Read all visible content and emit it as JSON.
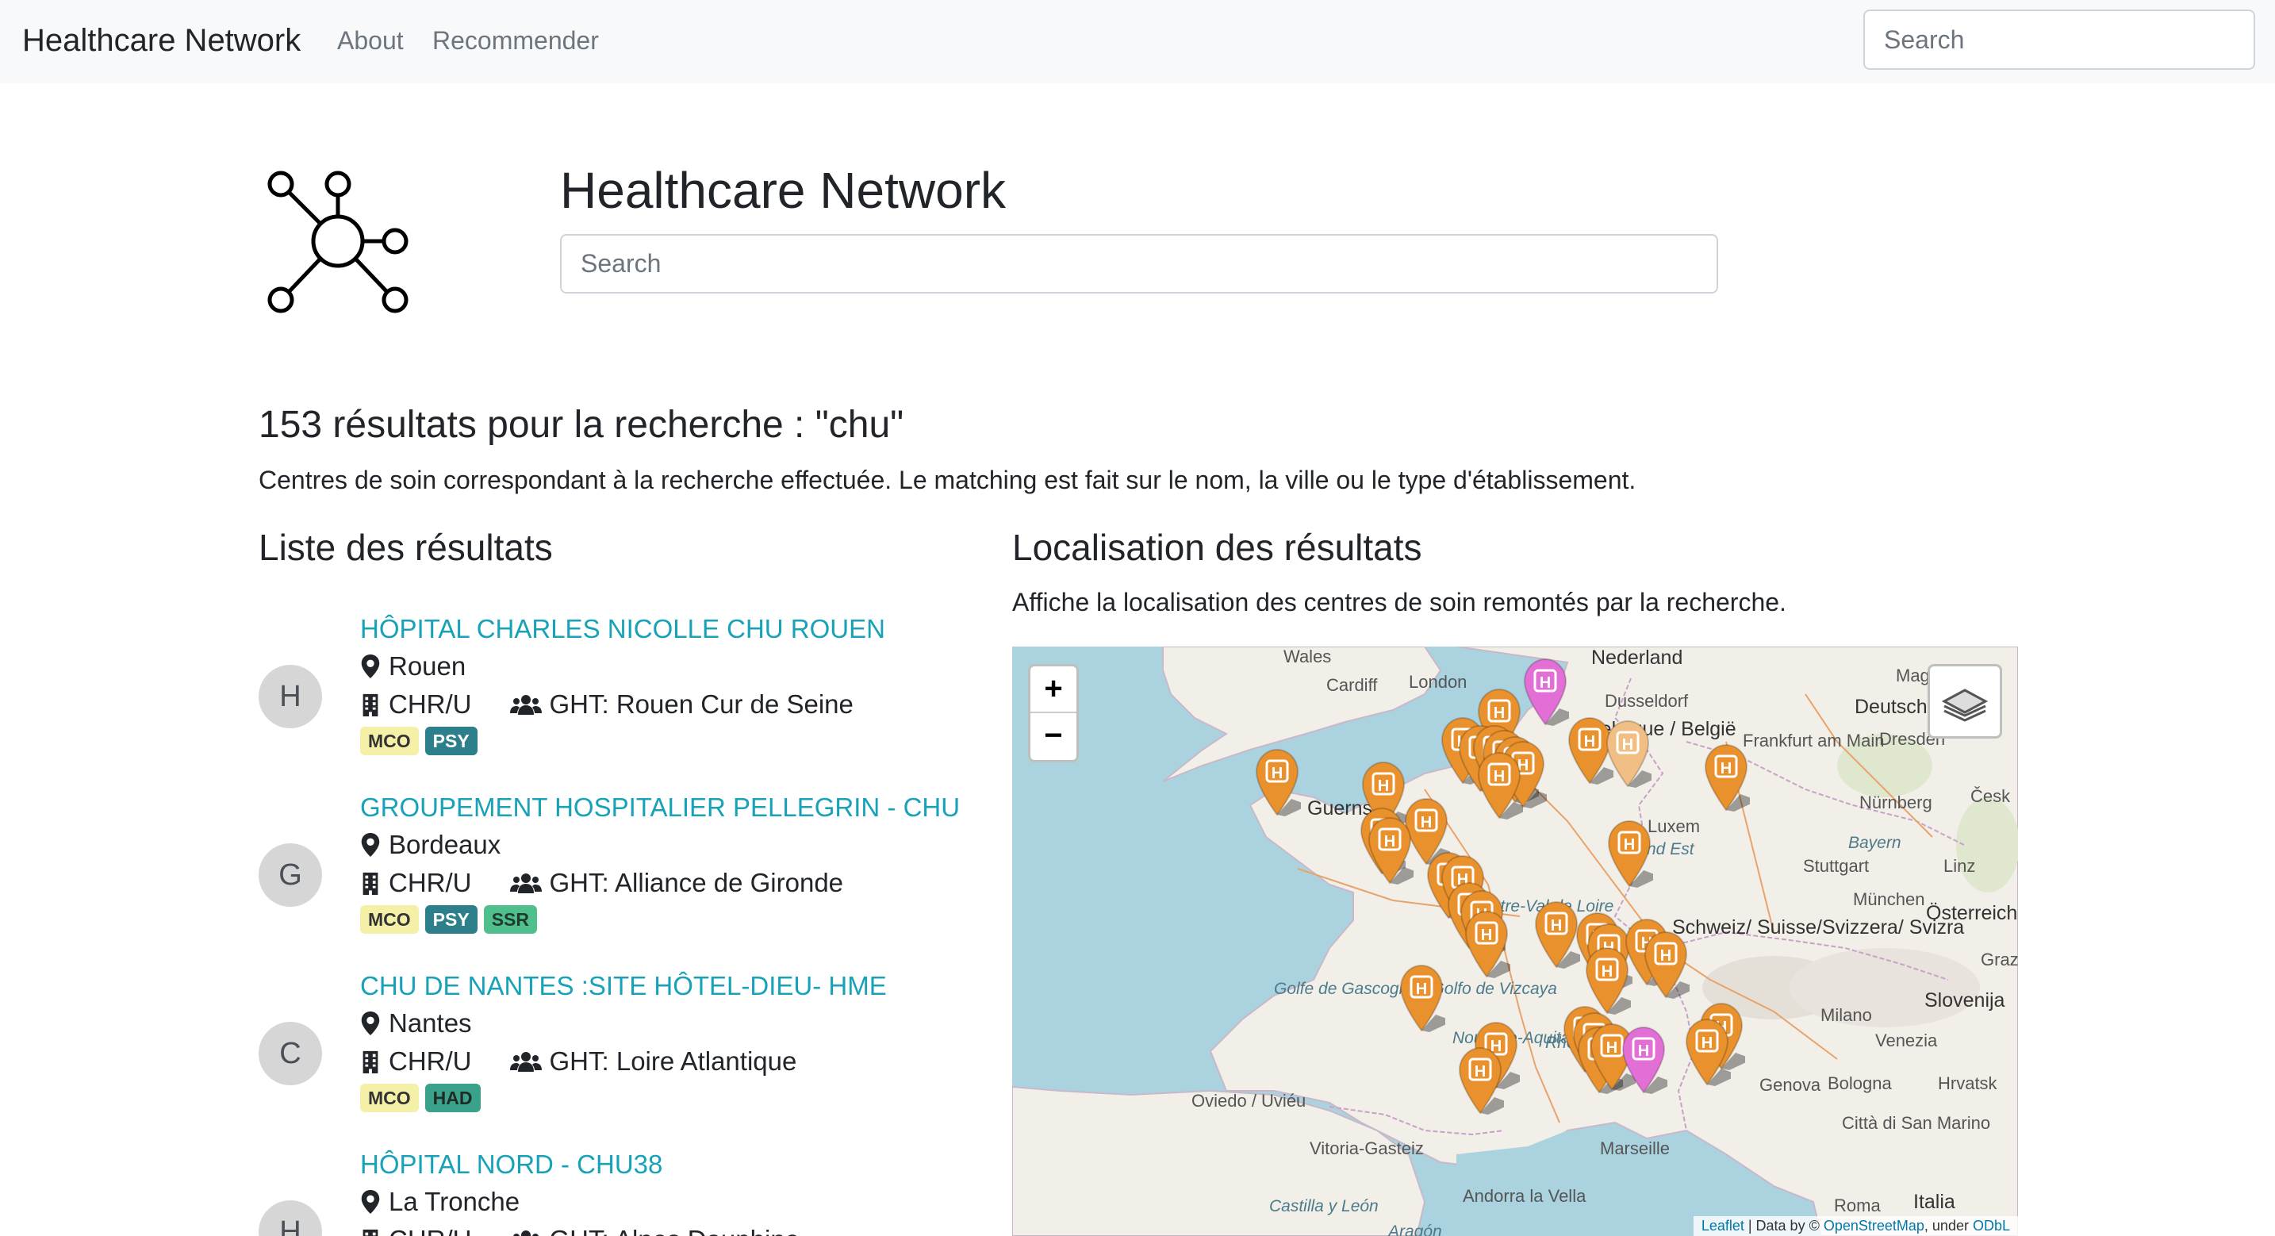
{
  "navbar": {
    "brand": "Healthcare Network",
    "links": [
      "About",
      "Recommender"
    ],
    "search_placeholder": "Search"
  },
  "hero": {
    "title": "Healthcare Network",
    "search_placeholder": "Search"
  },
  "results": {
    "heading": "153 résultats pour la recherche : \"chu\"",
    "description": "Centres de soin correspondant à la recherche effectuée. Le matching est fait sur le nom, la ville ou le type d'établissement."
  },
  "list": {
    "title": "Liste des résultats",
    "items": [
      {
        "initial": "H",
        "name": "HÔPITAL CHARLES NICOLLE CHU ROUEN",
        "city": "Rouen",
        "type": "CHR/U",
        "ght": "GHT: Rouen Cur de Seine",
        "badges": [
          "MCO",
          "PSY"
        ]
      },
      {
        "initial": "G",
        "name": "GROUPEMENT HOSPITALIER PELLEGRIN - CHU",
        "city": "Bordeaux",
        "type": "CHR/U",
        "ght": "GHT: Alliance de Gironde",
        "badges": [
          "MCO",
          "PSY",
          "SSR"
        ]
      },
      {
        "initial": "C",
        "name": "CHU DE NANTES :SITE HÔTEL-DIEU- HME",
        "city": "Nantes",
        "type": "CHR/U",
        "ght": "GHT: Loire Atlantique",
        "badges": [
          "MCO",
          "HAD"
        ]
      },
      {
        "initial": "H",
        "name": "HÔPITAL NORD - CHU38",
        "city": "La Tronche",
        "type": "CHR/U",
        "ght": "GHT: Alpes Dauphine",
        "badges": []
      }
    ]
  },
  "badge_colors": {
    "MCO": {
      "bg": "#f5f0a8",
      "fg": "#333333"
    },
    "PSY": {
      "bg": "#2e7f8c",
      "fg": "#ffffff"
    },
    "SSR": {
      "bg": "#4fc08d",
      "fg": "#1e3b2c"
    },
    "HAD": {
      "bg": "#3aa18a",
      "fg": "#1e2b26"
    }
  },
  "map_section": {
    "title": "Localisation des résultats",
    "description": "Affiche la localisation des centres de soin remontés par la recherche.",
    "zoom_in": "+",
    "zoom_out": "−",
    "attribution": {
      "leaflet": "Leaflet",
      "middle": " | Data by © ",
      "osm": "OpenStreetMap",
      "under": ", under ",
      "odbl": "ODbL"
    },
    "places": [
      "Wales",
      "Cardiff",
      "London",
      "Nederland",
      "Magdeburg",
      "Dusseldorf",
      "Deutschland",
      "Belgique / België",
      "Frankfurt am Main",
      "Dresden",
      "Česk",
      "Guernsey",
      "Nürnberg",
      "Luxem",
      "Bayern",
      "Grand Est",
      "Stuttgart",
      "Linz",
      "München",
      "Österreich",
      "Centre-Val de Loire",
      "Schweiz/ Suisse/Svizzera/ Svizra",
      "Graz",
      "Golfe de Gascogne / Golfo de Vizcaya",
      "Slovenija",
      "Milano",
      "Nouvelle-Aquitaine",
      "Rhône",
      "Venezia",
      "Oviedo / Uviéu",
      "Genova",
      "Bologna",
      "Hrvatsk",
      "Città di San Marino",
      "Vitoria-Gasteiz",
      "Marseille",
      "Andorra la Vella",
      "Castilla y León",
      "Aragón",
      "Roma",
      "Italia"
    ],
    "marker_letter": "H",
    "marker_colors": {
      "orange": "#e8912d",
      "pink": "#e26fd6",
      "light": "#f1bf83"
    }
  }
}
